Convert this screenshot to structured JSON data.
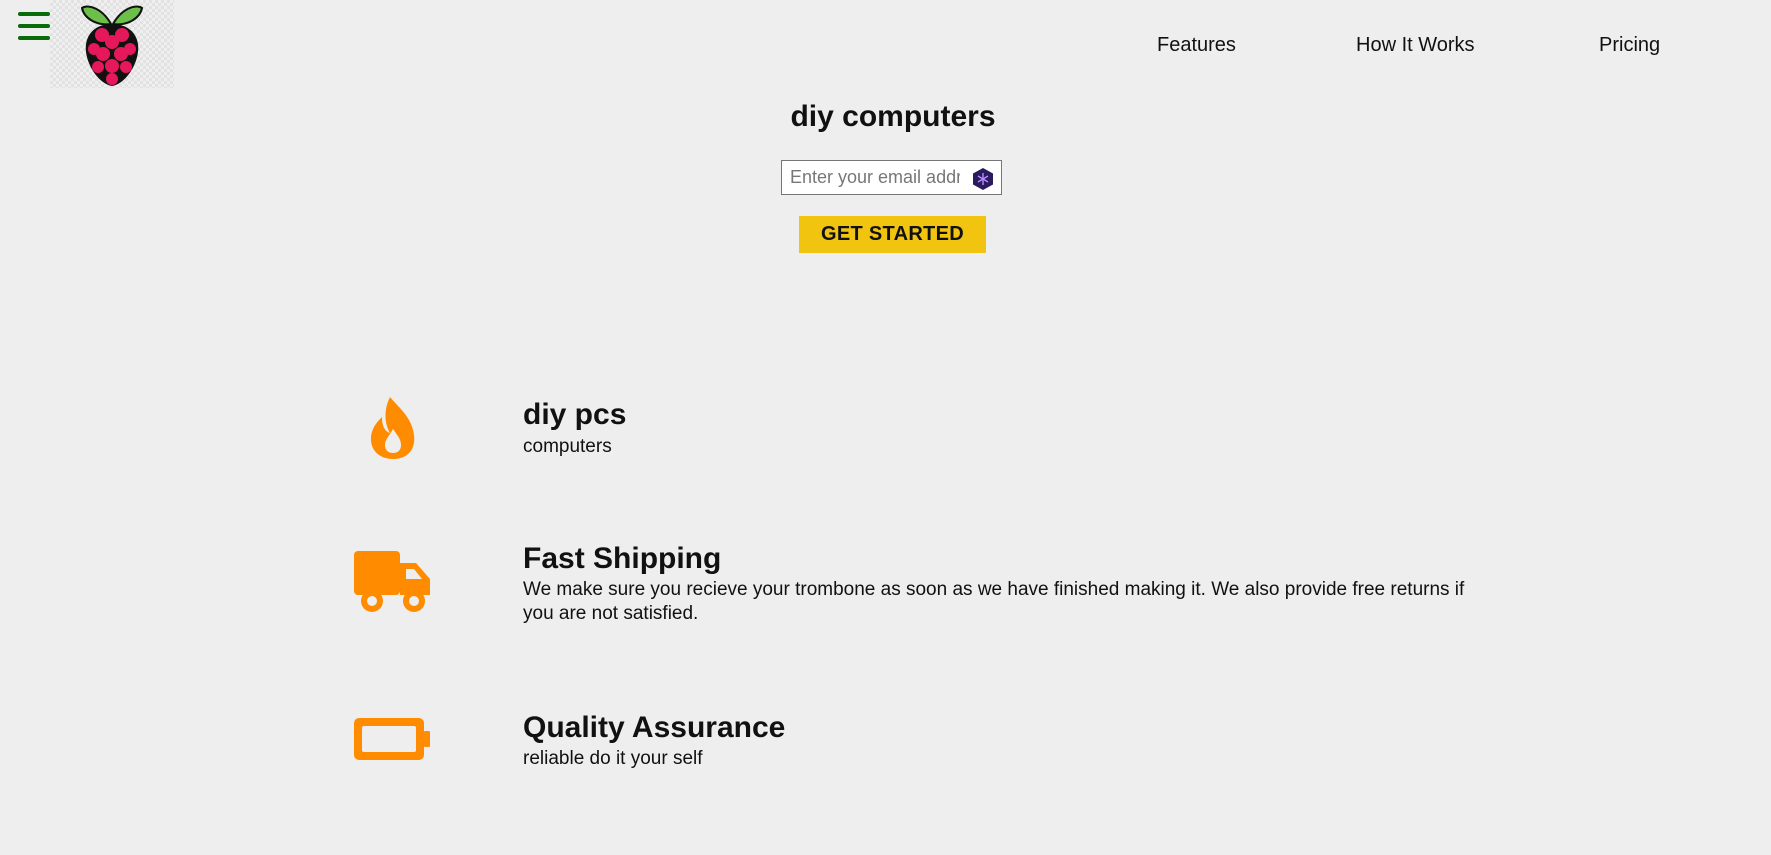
{
  "header": {
    "menu_icon": "hamburger-menu-icon",
    "logo_icon": "raspberry-pi-logo",
    "nav": {
      "features": "Features",
      "how_it_works": "How It Works",
      "pricing": "Pricing"
    }
  },
  "hero": {
    "title": "diy computers",
    "email_placeholder": "Enter your email address",
    "cta_label": "GET STARTED"
  },
  "features": [
    {
      "icon": "flame-icon",
      "title": "diy pcs",
      "description": "computers"
    },
    {
      "icon": "truck-icon",
      "title": "Fast Shipping",
      "description": "We make sure you recieve your trombone as soon as we have finished making it. We also provide free returns if you are not satisfied."
    },
    {
      "icon": "battery-icon",
      "title": "Quality Assurance",
      "description": "reliable do it your self"
    }
  ],
  "colors": {
    "background": "#eeeeee",
    "accent_orange": "#ff8c00",
    "cta_yellow": "#f1c40f",
    "menu_green": "#0a6b0a"
  }
}
